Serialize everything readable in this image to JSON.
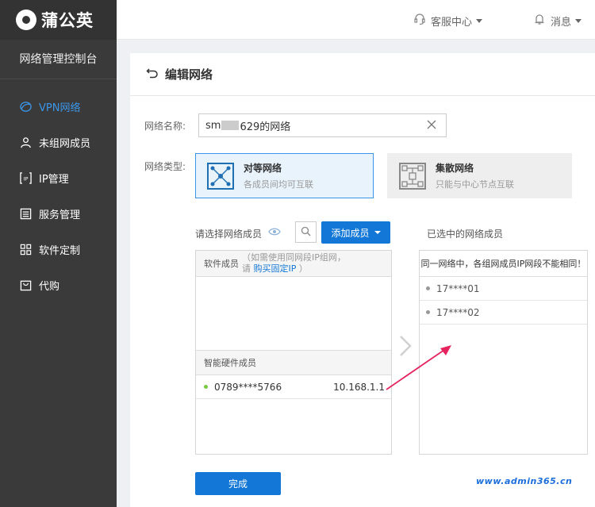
{
  "sidebar": {
    "logo_text": "蒲公英",
    "console_title": "网络管理控制台",
    "items": [
      {
        "label": "VPN网络",
        "icon": "globe-icon",
        "active": true
      },
      {
        "label": "未组网成员",
        "icon": "user-icon"
      },
      {
        "label": "IP管理",
        "icon": "ip-icon"
      },
      {
        "label": "服务管理",
        "icon": "list-icon"
      },
      {
        "label": "软件定制",
        "icon": "grid-icon"
      },
      {
        "label": "代购",
        "icon": "bag-icon"
      }
    ]
  },
  "topbar": {
    "service_label": "客服中心",
    "message_label": "消息"
  },
  "page": {
    "title": "编辑网络",
    "name_label": "网络名称:",
    "name_prefix": "sm",
    "name_suffix": "629的网络",
    "type_label": "网络类型:",
    "types": [
      {
        "title": "对等网络",
        "subtitle": "各成员间均可互联",
        "selected": true
      },
      {
        "title": "集散网络",
        "subtitle": "只能与中心节点互联",
        "selected": false
      }
    ]
  },
  "members": {
    "select_label": "请选择网络成员",
    "add_button": "添加成员",
    "selected_label": "已选中的网络成员",
    "software_header": "软件成员",
    "software_note_1": "（如需使用同网段IP组网，",
    "software_note_2_pre": "请",
    "software_note_link": "购买固定IP",
    "software_note_2_post": "）",
    "hardware_header": "智能硬件成员",
    "hardware": [
      {
        "name": "0789****5766",
        "ip": "10.168.1.1",
        "status_color": "#7ac943"
      }
    ],
    "right_warning": "同一网络中，各组网成员IP网段不能相同！",
    "selected": [
      {
        "name": "17****01"
      },
      {
        "name": "17****02"
      }
    ]
  },
  "footer": {
    "done_button": "完成",
    "watermark": "www.admin365.cn"
  },
  "colors": {
    "accent": "#1277d6",
    "sidebar_bg": "#3a3a3a",
    "annotation_arrow": "#e5245f"
  }
}
